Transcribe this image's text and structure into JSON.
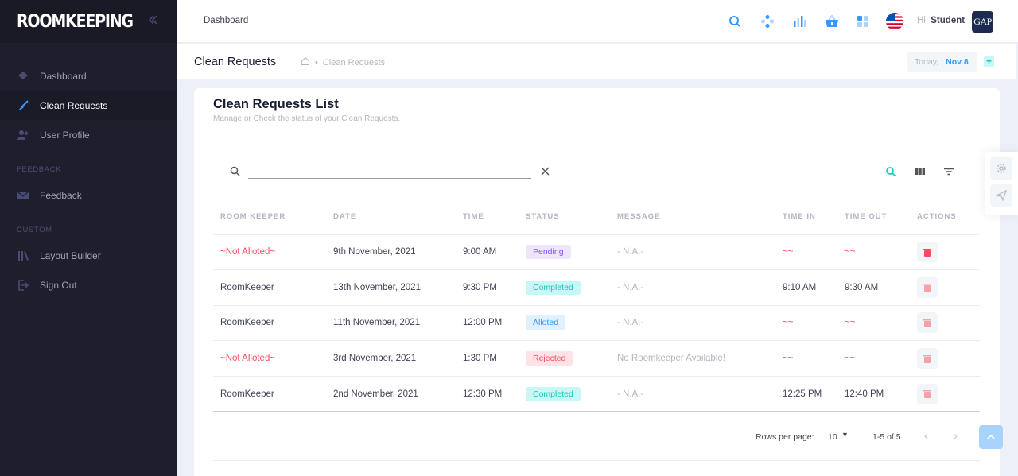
{
  "brand": {
    "logo": "ROOMKEEPING"
  },
  "sidebar": {
    "items": [
      {
        "label": "Dashboard",
        "icon": "layers-icon"
      },
      {
        "label": "Clean Requests",
        "icon": "broom-icon",
        "active": true
      },
      {
        "label": "User Profile",
        "icon": "user-add-icon"
      }
    ],
    "feedback_label": "FEEDBACK",
    "feedback_items": [
      {
        "label": "Feedback",
        "icon": "mail-icon"
      }
    ],
    "custom_label": "CUSTOM",
    "custom_items": [
      {
        "label": "Layout Builder",
        "icon": "library-icon"
      },
      {
        "label": "Sign Out",
        "icon": "sign-out-icon"
      }
    ]
  },
  "header": {
    "crumb": "Dashboard",
    "greeting_prefix": "Hi,",
    "user_name": "Student",
    "logo_text": "GAP"
  },
  "subheader": {
    "title": "Clean Requests",
    "crumb_current": "Clean Requests",
    "today_label": "Today,",
    "today_date": "Nov 8",
    "add_label": "+"
  },
  "card": {
    "title": "Clean Requests List",
    "subtitle": "Manage or Check the status of your Clean Requests.",
    "search_placeholder": ""
  },
  "table": {
    "columns": [
      "ROOM KEEPER",
      "DATE",
      "TIME",
      "STATUS",
      "MESSAGE",
      "TIME IN",
      "TIME OUT",
      "ACTIONS"
    ],
    "rows": [
      {
        "keeper": "~Not Alloted~",
        "date": "9th November, 2021",
        "time": "9:00 AM",
        "status": "Pending",
        "message": "- N.A.-",
        "time_in": "~~",
        "time_out": "~~"
      },
      {
        "keeper": "RoomKeeper",
        "date": "13th November, 2021",
        "time": "9:30 PM",
        "status": "Completed",
        "message": "- N.A.-",
        "time_in": "9:10 AM",
        "time_out": "9:30 AM"
      },
      {
        "keeper": "RoomKeeper",
        "date": "11th November, 2021",
        "time": "12:00 PM",
        "status": "Alloted",
        "message": "- N.A.-",
        "time_in": "~~",
        "time_out": "~~"
      },
      {
        "keeper": "~Not Alloted~",
        "date": "3rd November, 2021",
        "time": "1:30 PM",
        "status": "Rejected",
        "message": "No Roomkeeper Available!",
        "time_in": "~~",
        "time_out": "~~"
      },
      {
        "keeper": "RoomKeeper",
        "date": "2nd November, 2021",
        "time": "12:30 PM",
        "status": "Completed",
        "message": "- N.A.-",
        "time_in": "12:25 PM",
        "time_out": "12:40 PM"
      }
    ]
  },
  "pager": {
    "rows_per_page_label": "Rows per page:",
    "rows_per_page_value": "10",
    "range": "1-5 of 5"
  },
  "colors": {
    "sidebar": "#1e1e2d",
    "primary": "#3699ff",
    "danger": "#f64e60",
    "success": "#1bc5bd"
  }
}
